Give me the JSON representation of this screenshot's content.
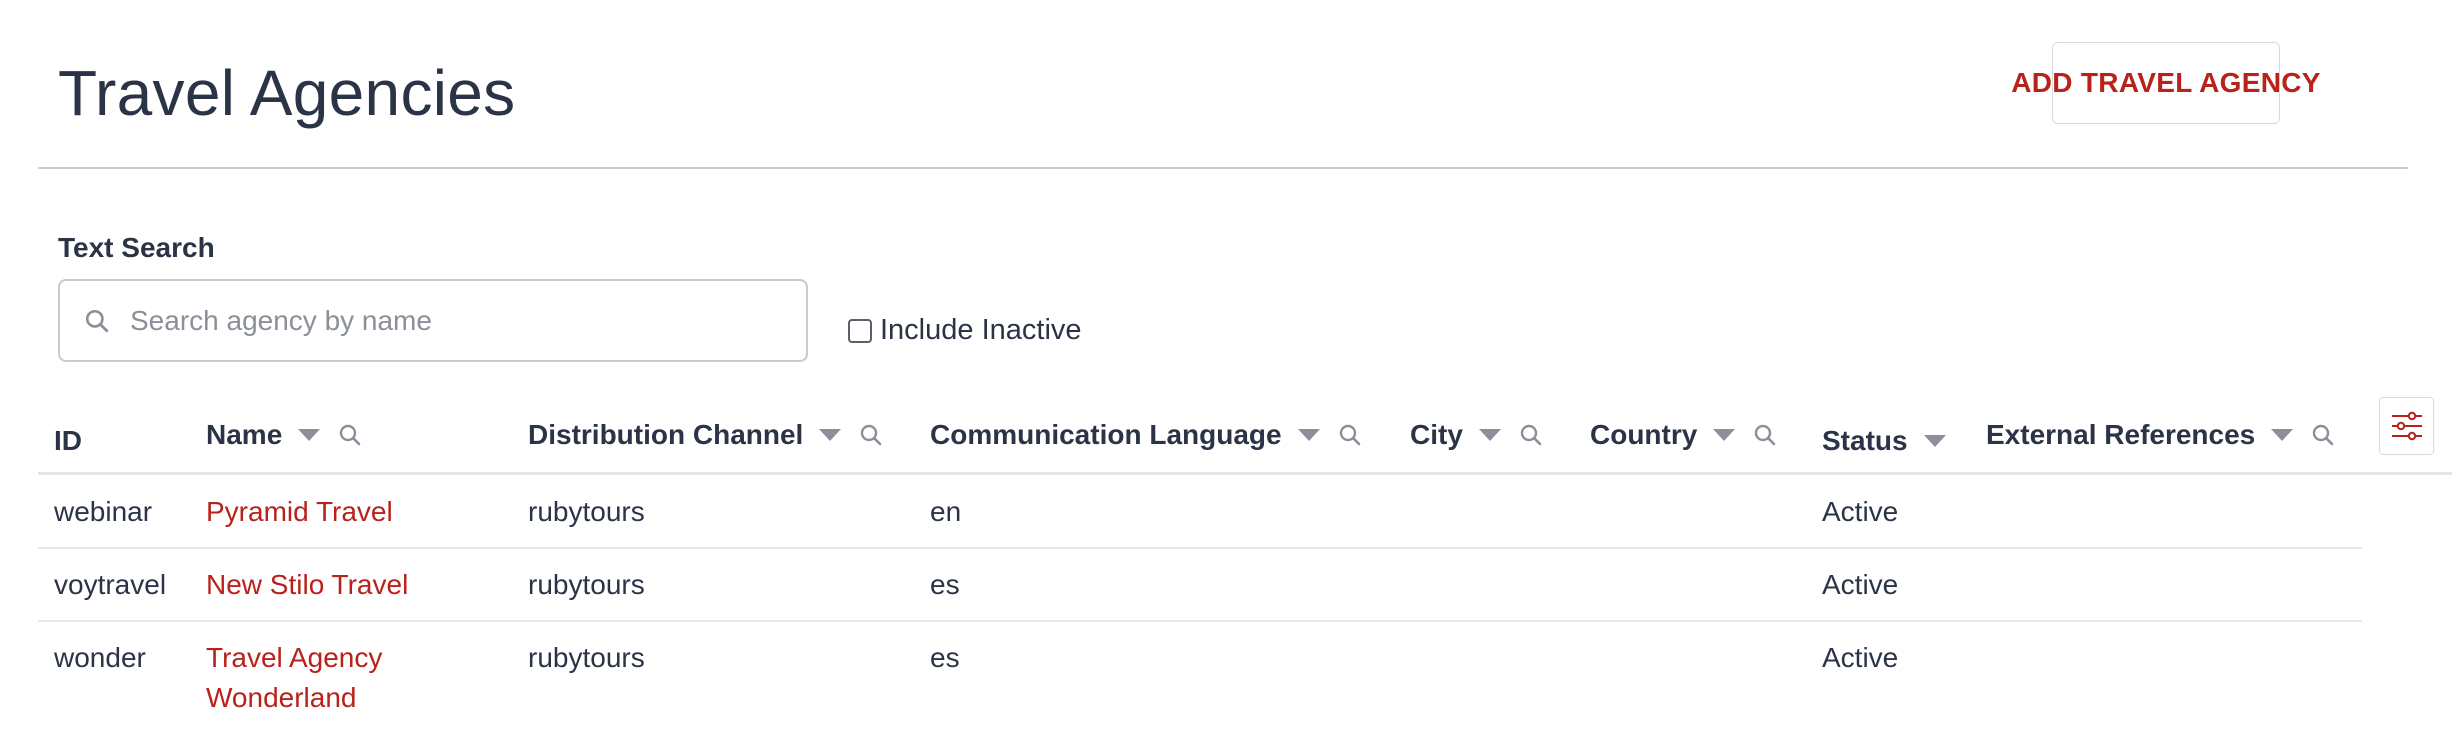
{
  "page": {
    "title": "Travel Agencies",
    "add_button_label": "ADD TRAVEL AGENCY"
  },
  "search": {
    "label": "Text Search",
    "placeholder": "Search agency by name",
    "value": "",
    "include_inactive_label": "Include Inactive",
    "include_inactive_checked": false
  },
  "table": {
    "columns": {
      "id": "ID",
      "name": "Name",
      "distribution_channel": "Distribution Channel",
      "communication_language": "Communication Language",
      "city": "City",
      "country": "Country",
      "status": "Status",
      "external_references": "External References"
    },
    "rows": [
      {
        "id": "webinar",
        "name": "Pyramid Travel",
        "distribution_channel": "rubytours",
        "communication_language": "en",
        "city": "",
        "country": "",
        "status": "Active",
        "external_references": ""
      },
      {
        "id": "voytravel",
        "name": "New Stilo Travel",
        "distribution_channel": "rubytours",
        "communication_language": "es",
        "city": "",
        "country": "",
        "status": "Active",
        "external_references": ""
      },
      {
        "id": "wonder",
        "name_line1": "Travel Agency",
        "name_line2": "Wonderland",
        "distribution_channel": "rubytours",
        "communication_language": "es",
        "city": "",
        "country": "",
        "status": "Active",
        "external_references": ""
      }
    ]
  },
  "icons": {
    "search": "search-icon",
    "sort": "sort-down-icon",
    "column_settings": "sliders-icon"
  },
  "colors": {
    "accent": "#b8221a",
    "text": "#2b3447",
    "muted": "#8a8f99"
  }
}
